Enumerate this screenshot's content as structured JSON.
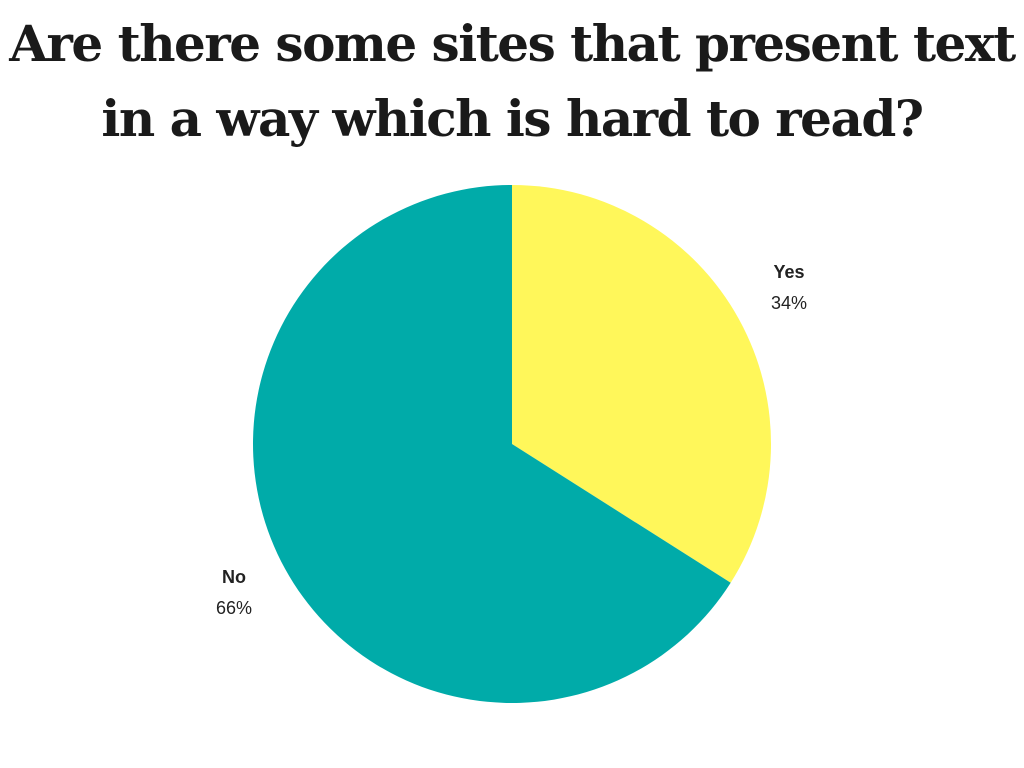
{
  "chart_data": {
    "type": "pie",
    "title": "Are there some sites that present text in a way which is hard to read?",
    "slices": [
      {
        "label": "Yes",
        "value": 34,
        "value_label": "34%",
        "color": "#FFF75A"
      },
      {
        "label": "No",
        "value": 66,
        "value_label": "66%",
        "color": "#00ABA9"
      }
    ],
    "start": "12 o'clock",
    "direction": "clockwise"
  }
}
